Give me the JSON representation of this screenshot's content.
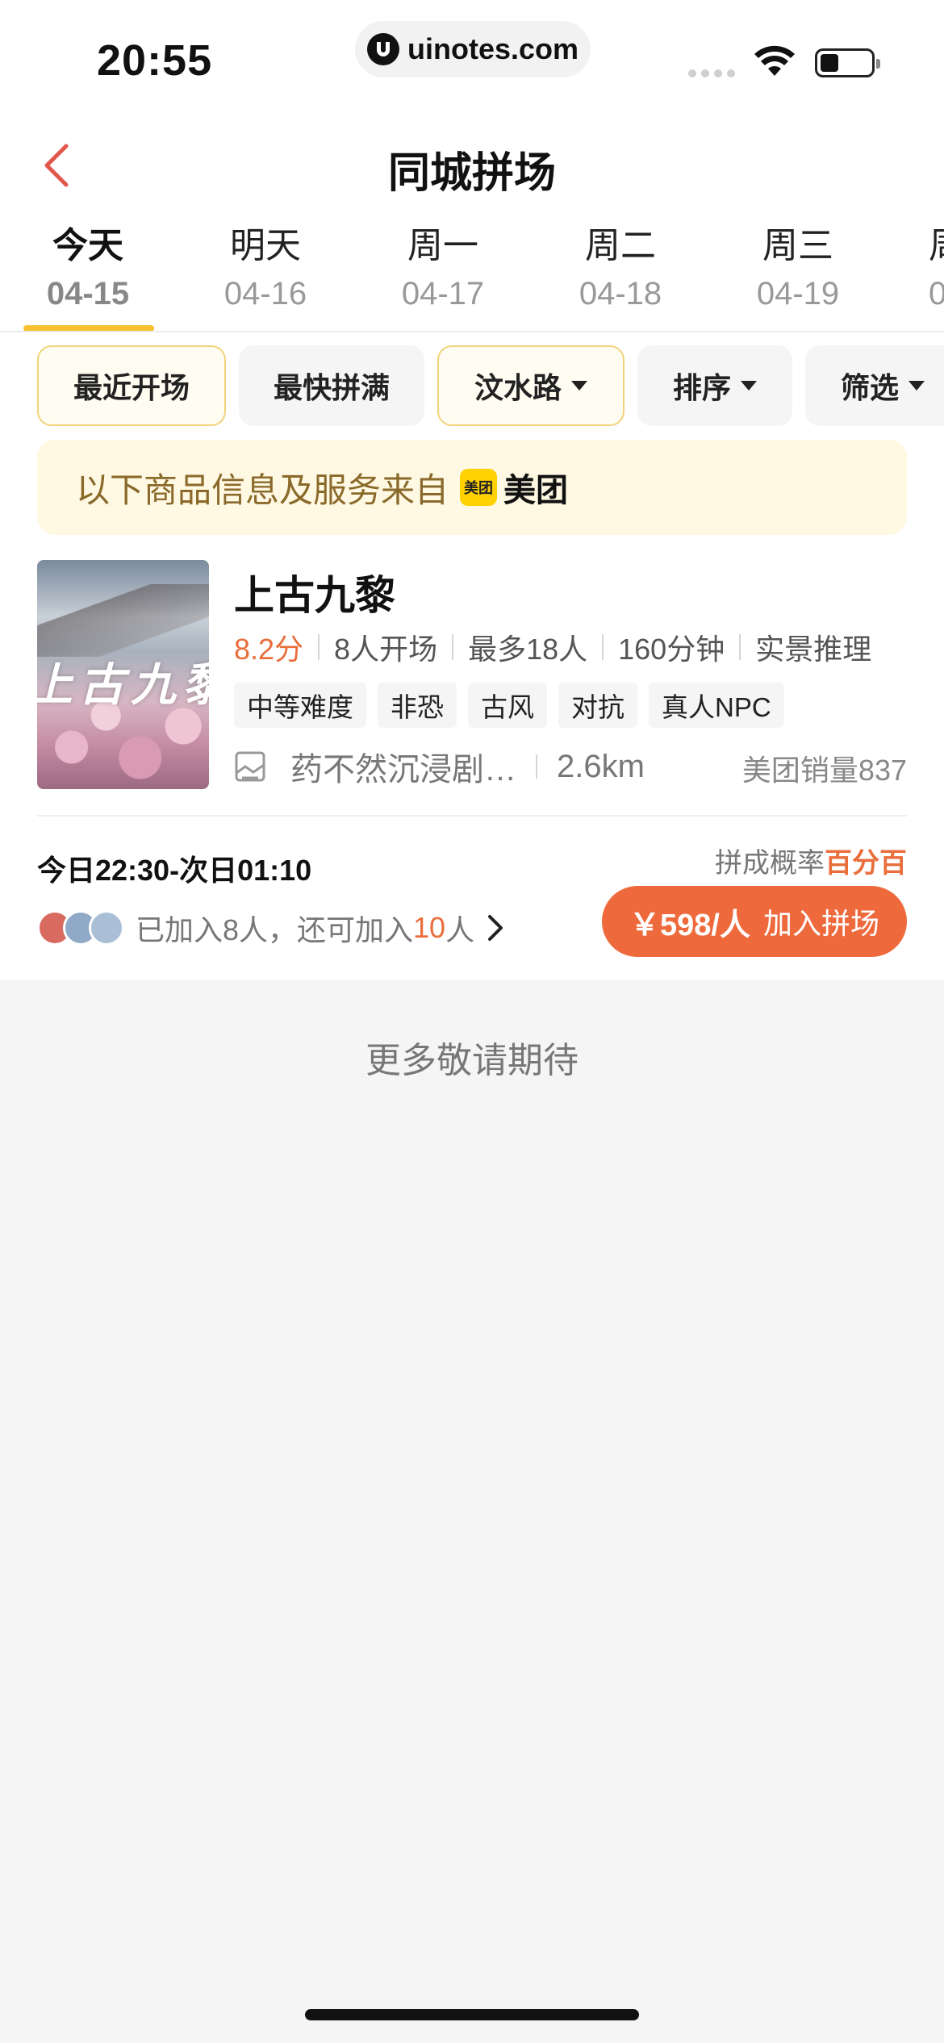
{
  "status_bar": {
    "time": "20:55",
    "url": "uinotes.com"
  },
  "nav": {
    "title": "同城拼场"
  },
  "date_tabs": [
    {
      "day": "今天",
      "date": "04-15",
      "active": true
    },
    {
      "day": "明天",
      "date": "04-16",
      "active": false
    },
    {
      "day": "周一",
      "date": "04-17",
      "active": false
    },
    {
      "day": "周二",
      "date": "04-18",
      "active": false
    },
    {
      "day": "周三",
      "date": "04-19",
      "active": false
    },
    {
      "day": "周",
      "date": "0",
      "active": false
    }
  ],
  "filters": [
    {
      "label": "最近开场",
      "dropdown": false,
      "selected": true
    },
    {
      "label": "最快拼满",
      "dropdown": false,
      "selected": false
    },
    {
      "label": "汶水路",
      "dropdown": true,
      "selected": true
    },
    {
      "label": "排序",
      "dropdown": true,
      "selected": false
    },
    {
      "label": "筛选",
      "dropdown": true,
      "selected": false
    }
  ],
  "notice": {
    "text": "以下商品信息及服务来自",
    "logo_text": "美团",
    "brand": "美团"
  },
  "product": {
    "title": "上古九黎",
    "image_text": "上古九黎",
    "score": "8.2分",
    "meta": [
      "8人开场",
      "最多18人",
      "160分钟",
      "实景推理"
    ],
    "tags": [
      "中等难度",
      "非恐",
      "古风",
      "对抗",
      "真人NPC"
    ],
    "store": "药不然沉浸剧…",
    "distance": "2.6km",
    "sales": "美团销量837"
  },
  "session": {
    "time": "今日22:30-次日01:10",
    "rate_label": "拼成概率",
    "rate_value": "百分百",
    "joined_text": "已加入8人，还可加入",
    "remaining": "10",
    "unit": "人",
    "price": "￥598/人",
    "button_label": "加入拼场"
  },
  "footer": {
    "more_text": "更多敬请期待"
  },
  "colors": {
    "accent": "#ee6a3d",
    "tab_underline": "#f7c232",
    "notice_bg": "#fff8e3"
  }
}
